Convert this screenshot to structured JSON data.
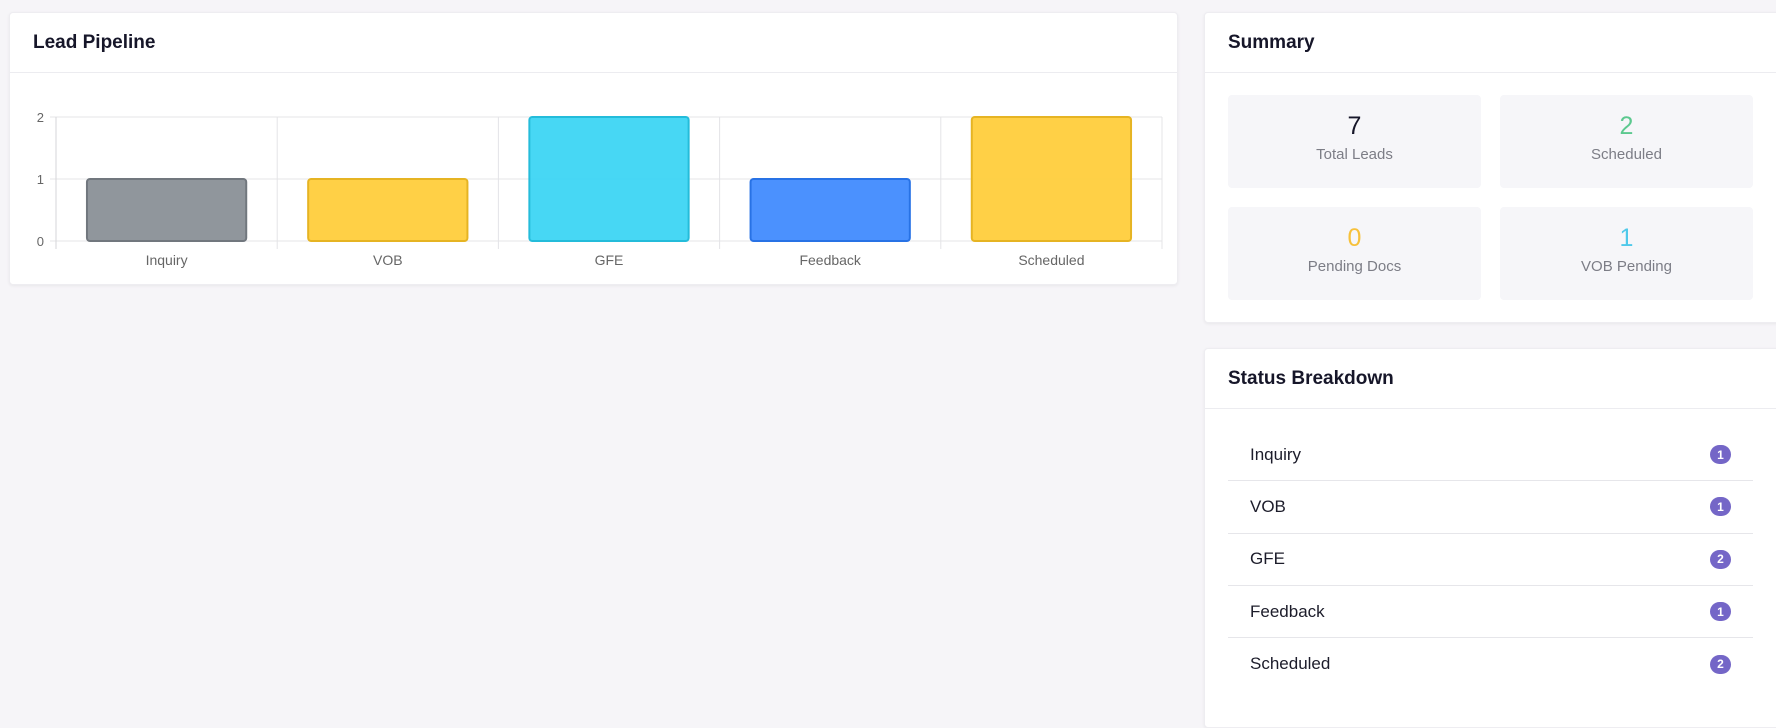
{
  "pipeline": {
    "title": "Lead Pipeline"
  },
  "chart_data": {
    "type": "bar",
    "categories": [
      "Inquiry",
      "VOB",
      "GFE",
      "Feedback",
      "Scheduled"
    ],
    "values": [
      1,
      1,
      2,
      1,
      2
    ],
    "colors": [
      "#8a9097",
      "#ffcd3c",
      "#3dd5f3",
      "#418bfe",
      "#ffcd3c"
    ],
    "ylim": [
      0,
      2
    ],
    "yticks": [
      0,
      1,
      2
    ],
    "grid": true,
    "legend": "none"
  },
  "summary": {
    "title": "Summary",
    "stats": [
      {
        "value": "7",
        "label": "Total Leads",
        "color": "#161629"
      },
      {
        "value": "2",
        "label": "Scheduled",
        "color": "#5cc98f"
      },
      {
        "value": "0",
        "label": "Pending Docs",
        "color": "#f7c13b"
      },
      {
        "value": "1",
        "label": "VOB Pending",
        "color": "#4fc9ea"
      }
    ]
  },
  "status": {
    "title": "Status Breakdown",
    "items": [
      {
        "label": "Inquiry",
        "count": "1"
      },
      {
        "label": "VOB",
        "count": "1"
      },
      {
        "label": "GFE",
        "count": "2"
      },
      {
        "label": "Feedback",
        "count": "1"
      },
      {
        "label": "Scheduled",
        "count": "2"
      }
    ],
    "badge_color": "#7466c7"
  }
}
